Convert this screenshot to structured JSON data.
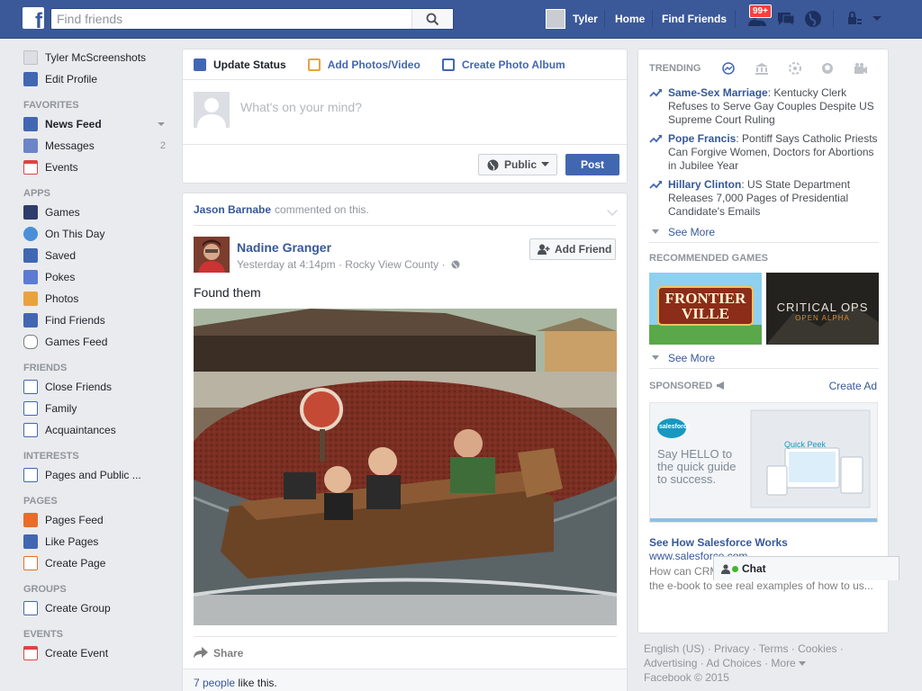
{
  "topbar": {
    "search_placeholder": "Find friends",
    "user_name": "Tyler",
    "home": "Home",
    "find_friends": "Find Friends",
    "notifications_badge": "99+",
    "colors": {
      "bar": "#3b5998",
      "badge": "#fa3e3e"
    }
  },
  "sidebar": {
    "profile": [
      {
        "label": "Tyler McScreenshots",
        "icon": "avatar"
      },
      {
        "label": "Edit Profile",
        "icon": "pencil-icon"
      }
    ],
    "favorites_head": "FAVORITES",
    "favorites": [
      {
        "label": "News Feed",
        "icon": "news-feed-icon"
      },
      {
        "label": "Messages",
        "icon": "messages-icon",
        "count": "2"
      },
      {
        "label": "Events",
        "icon": "calendar-icon"
      }
    ],
    "apps_head": "APPS",
    "apps": [
      {
        "label": "Games",
        "icon": "games-icon"
      },
      {
        "label": "On This Day",
        "icon": "clock-icon"
      },
      {
        "label": "Saved",
        "icon": "bookmark-icon"
      },
      {
        "label": "Pokes",
        "icon": "poke-icon"
      },
      {
        "label": "Photos",
        "icon": "photos-icon"
      },
      {
        "label": "Find Friends",
        "icon": "find-friends-icon"
      },
      {
        "label": "Games Feed",
        "icon": "gamepad-icon"
      }
    ],
    "friends_head": "FRIENDS",
    "friends": [
      {
        "label": "Close Friends",
        "icon": "star-icon"
      },
      {
        "label": "Family",
        "icon": "house-icon"
      },
      {
        "label": "Acquaintances",
        "icon": "list-icon"
      }
    ],
    "interests_head": "INTERESTS",
    "interests": [
      {
        "label": "Pages and Public ...",
        "icon": "pages-icon"
      }
    ],
    "pages_head": "PAGES",
    "pages": [
      {
        "label": "Pages Feed",
        "icon": "flag-icon"
      },
      {
        "label": "Like Pages",
        "icon": "thumbs-up-icon"
      },
      {
        "label": "Create Page",
        "icon": "create-page-icon"
      }
    ],
    "groups_head": "GROUPS",
    "groups": [
      {
        "label": "Create Group",
        "icon": "plus-icon"
      }
    ],
    "events_head": "EVENTS",
    "events": [
      {
        "label": "Create Event",
        "icon": "create-event-icon"
      }
    ]
  },
  "composer": {
    "tab_update": "Update Status",
    "tab_photos": "Add Photos/Video",
    "tab_album": "Create Photo Album",
    "placeholder": "What's on your mind?",
    "privacy": "Public",
    "post": "Post"
  },
  "post": {
    "activity_actor": "Jason Barnabe",
    "activity_text": "commented on this.",
    "author": "Nadine Granger",
    "meta": "Yesterday at 4:14pm · Rocky View County ·",
    "add_friend": "Add Friend",
    "text": "Found them",
    "share": "Share",
    "likes_link": "7 people",
    "likes_text": "like this."
  },
  "right": {
    "trending_head": "TRENDING",
    "trends": [
      {
        "topic": "Same-Sex Marriage",
        "text": ": Kentucky Clerk Refuses to Serve Gay Couples Despite US Supreme Court Ruling"
      },
      {
        "topic": "Pope Francis",
        "text": ": Pontiff Says Catholic Priests Can Forgive Women, Doctors for Abortions in Jubilee Year"
      },
      {
        "topic": "Hillary Clinton",
        "text": ": US State Department Releases 7,000 Pages of Presidential Candidate's Emails"
      }
    ],
    "see_more": "See More",
    "games_head": "RECOMMENDED GAMES",
    "game1": "FRONTIER VILLE",
    "game2_title": "CRITICAL OPS",
    "game2_sub": "OPEN ALPHA",
    "see_more2": "See More",
    "sponsored_head": "SPONSORED",
    "create_ad": "Create Ad",
    "ad_brand": "salesforce",
    "ad_slogan": "Say HELLO to the quick guide to success.",
    "ad_quick": "Quick Peek",
    "ad_title": "See How Salesforce Works",
    "ad_url": "www.salesforce.com",
    "ad_desc": "How can CRM help you sell faster? Download the e-book to see real examples of how to us..."
  },
  "chat": {
    "label": "Chat"
  },
  "footer": {
    "line1": "English (US) · Privacy · Terms · Cookies ·",
    "line2": "Advertising · Ad Choices · More",
    "line3": "Facebook © 2015"
  }
}
